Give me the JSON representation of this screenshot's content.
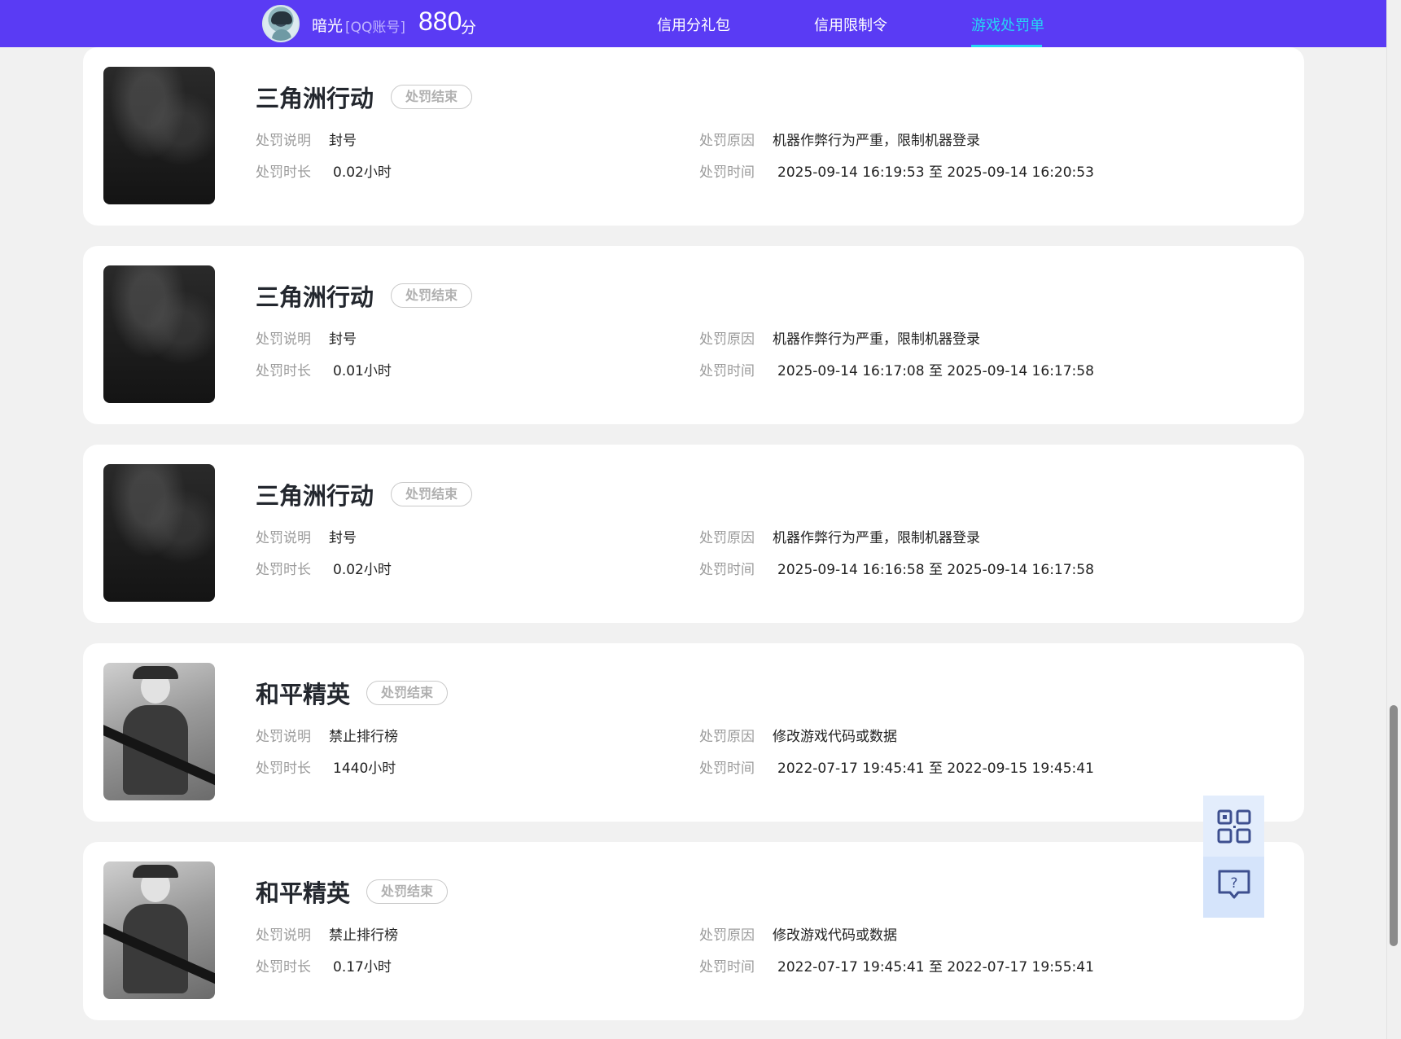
{
  "header": {
    "user_name": "暗光",
    "account_type": "[QQ账号]",
    "score": "880",
    "score_unit": "分",
    "tabs": [
      {
        "label": "信用分礼包",
        "active": false
      },
      {
        "label": "信用限制令",
        "active": false
      },
      {
        "label": "游戏处罚单",
        "active": true
      }
    ],
    "accent_color": "#5a3bf4",
    "active_tab_color": "#25d6f4"
  },
  "labels": {
    "desc": "处罚说明",
    "duration": "处罚时长",
    "reason": "处罚原因",
    "time": "处罚时间"
  },
  "cards": [
    {
      "game": "三角洲行动",
      "status": "处罚结束",
      "desc": "封号",
      "duration": "0.02小时",
      "reason": "机器作弊行为严重，限制机器登录",
      "time": "2025-09-14 16:19:53 至 2025-09-14 16:20:53"
    },
    {
      "game": "三角洲行动",
      "status": "处罚结束",
      "desc": "封号",
      "duration": "0.01小时",
      "reason": "机器作弊行为严重，限制机器登录",
      "time": "2025-09-14 16:17:08 至 2025-09-14 16:17:58"
    },
    {
      "game": "三角洲行动",
      "status": "处罚结束",
      "desc": "封号",
      "duration": "0.02小时",
      "reason": "机器作弊行为严重，限制机器登录",
      "time": "2025-09-14 16:16:58 至 2025-09-14 16:17:58"
    },
    {
      "game": "和平精英",
      "status": "处罚结束",
      "desc": "禁止排行榜",
      "duration": "1440小时",
      "reason": "修改游戏代码或数据",
      "time": "2022-07-17 19:45:41 至 2022-09-15 19:45:41"
    },
    {
      "game": "和平精英",
      "status": "处罚结束",
      "desc": "禁止排行榜",
      "duration": "0.17小时",
      "reason": "修改游戏代码或数据",
      "time": "2022-07-17 19:45:41 至 2022-07-17 19:55:41"
    }
  ],
  "float_tools": {
    "qr_icon": "qr-code-icon",
    "help_icon": "help-chat-icon"
  }
}
